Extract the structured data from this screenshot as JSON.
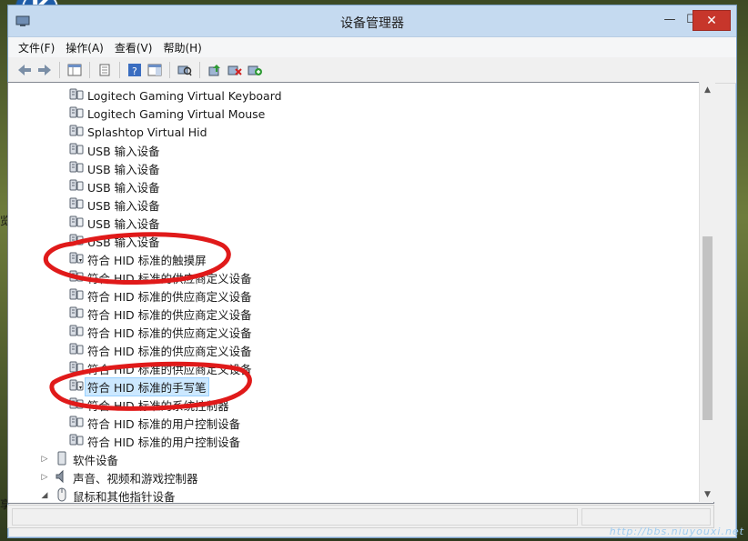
{
  "window": {
    "title": "设备管理器",
    "close_glyph": "✕",
    "max_glyph": "☐",
    "min_glyph": "—"
  },
  "menu": [
    "文件(F)",
    "操作(A)",
    "查看(V)",
    "帮助(H)"
  ],
  "tree": {
    "children": [
      {
        "label": "Logitech Gaming Virtual Keyboard",
        "icon": "hid-device-icon"
      },
      {
        "label": "Logitech Gaming Virtual Mouse",
        "icon": "hid-device-icon"
      },
      {
        "label": "Splashtop Virtual Hid",
        "icon": "hid-device-icon"
      },
      {
        "label": "USB 输入设备",
        "icon": "hid-device-icon"
      },
      {
        "label": "USB 输入设备",
        "icon": "hid-device-icon"
      },
      {
        "label": "USB 输入设备",
        "icon": "hid-device-icon"
      },
      {
        "label": "USB 输入设备",
        "icon": "hid-device-icon"
      },
      {
        "label": "USB 输入设备",
        "icon": "hid-device-icon"
      },
      {
        "label": "USB 输入设备",
        "icon": "hid-device-icon"
      },
      {
        "label": "符合 HID 标准的触摸屏",
        "icon": "hid-device-disabled-icon"
      },
      {
        "label": "符合 HID 标准的供应商定义设备",
        "icon": "hid-device-icon"
      },
      {
        "label": "符合 HID 标准的供应商定义设备",
        "icon": "hid-device-icon"
      },
      {
        "label": "符合 HID 标准的供应商定义设备",
        "icon": "hid-device-icon"
      },
      {
        "label": "符合 HID 标准的供应商定义设备",
        "icon": "hid-device-icon"
      },
      {
        "label": "符合 HID 标准的供应商定义设备",
        "icon": "hid-device-icon"
      },
      {
        "label": "符合 HID 标准的供应商定义设备",
        "icon": "hid-device-icon"
      },
      {
        "label": "符合 HID 标准的手写笔",
        "icon": "hid-device-disabled-icon",
        "selected": true
      },
      {
        "label": "符合 HID 标准的系统控制器",
        "icon": "hid-device-icon"
      },
      {
        "label": "符合 HID 标准的用户控制设备",
        "icon": "hid-device-icon"
      },
      {
        "label": "符合 HID 标准的用户控制设备",
        "icon": "hid-device-icon"
      }
    ],
    "categories": [
      {
        "label": "软件设备",
        "expander": "▷",
        "icon": "software-device-icon"
      },
      {
        "label": "声音、视频和游戏控制器",
        "expander": "▷",
        "icon": "speaker-icon"
      },
      {
        "label": "鼠标和其他指针设备",
        "expander": "◢",
        "icon": "mouse-icon"
      }
    ]
  },
  "desktop": {
    "icon_letter": "K",
    "side_chars": [
      "览",
      "享"
    ]
  },
  "watermark": "http://bbs.niuyouxi.net"
}
